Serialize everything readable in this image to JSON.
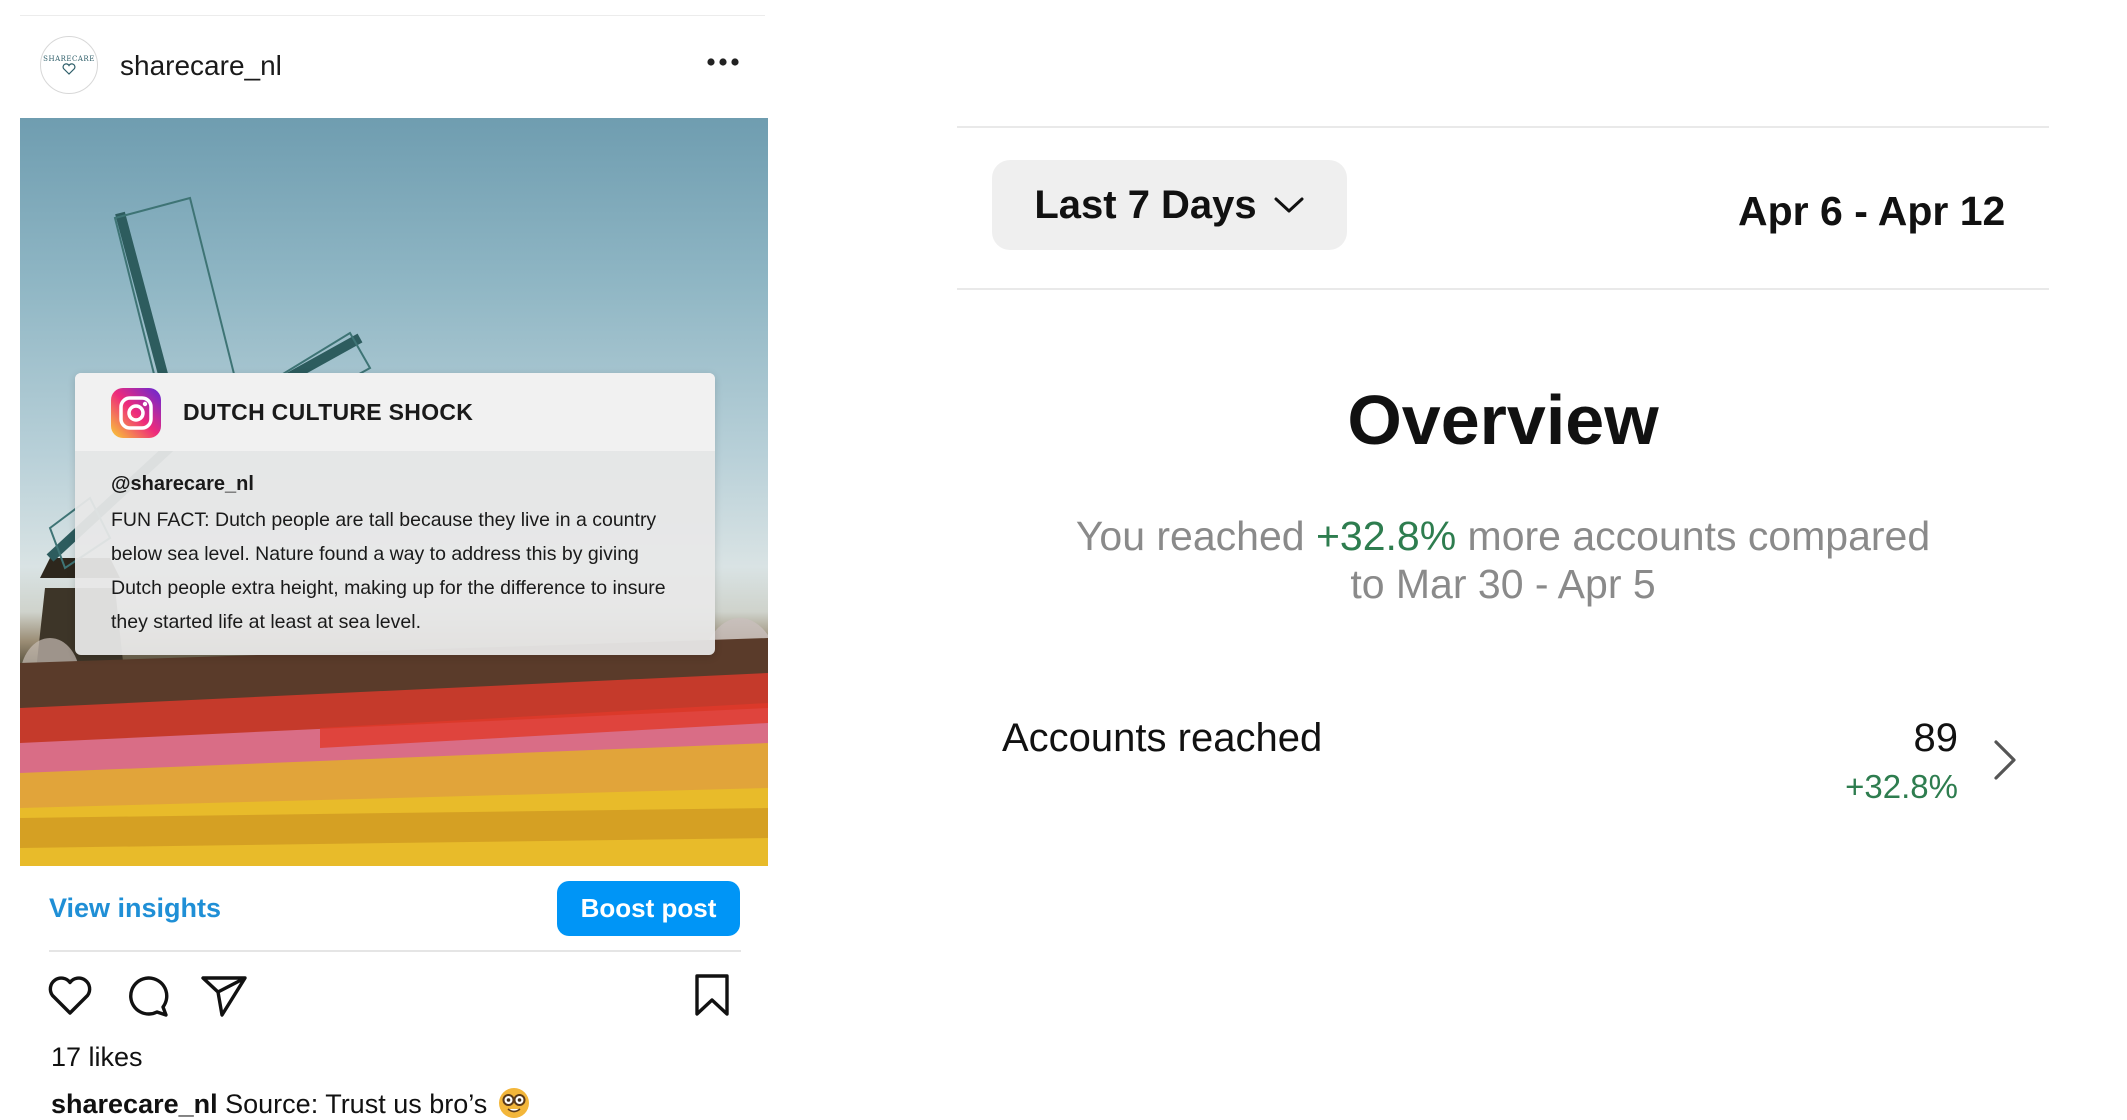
{
  "post": {
    "username": "sharecare_nl",
    "avatar_text": "SHARECARE",
    "overlay": {
      "title": "DUTCH CULTURE SHOCK",
      "handle": "@sharecare_nl",
      "body": "FUN FACT: Dutch people are tall because they live in a country below sea level. Nature found a way to address this by giving Dutch people extra height, making up for the difference to insure they started life at least at sea level."
    },
    "view_insights_label": "View insights",
    "boost_post_label": "Boost post",
    "likes": "17 likes",
    "caption_user": "sharecare_nl",
    "caption_text": "Source: Trust us bro’s",
    "icons": [
      "more-icon",
      "heart-icon",
      "comment-icon",
      "share-icon",
      "bookmark-icon",
      "instagram-icon",
      "nerd-emoji-icon"
    ]
  },
  "insights": {
    "period_label": "Last 7 Days",
    "date_range": "Apr 6 - Apr 12",
    "overview_title": "Overview",
    "compare_prefix": "You reached ",
    "compare_pct": "+32.8%",
    "compare_suffix": " more accounts compared",
    "compare_line2": "to Mar 30 - Apr 5",
    "metric": {
      "label": "Accounts reached",
      "value": "89",
      "change": "+32.8%"
    },
    "icons": [
      "chevron-down-icon",
      "chevron-right-icon"
    ]
  },
  "colors": {
    "accent_blue": "#0095f6",
    "link_blue": "#1f8fd6",
    "positive_green": "#2e7d4f",
    "muted_gray": "#8a8a8a"
  }
}
